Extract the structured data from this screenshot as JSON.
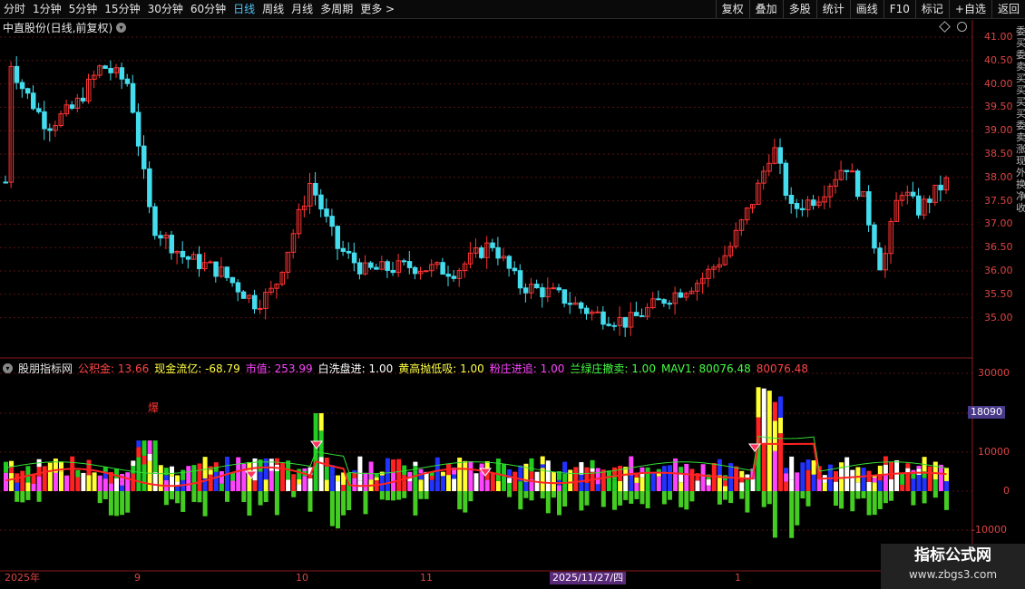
{
  "toolbar": {
    "periods": [
      "分时",
      "1分钟",
      "5分钟",
      "15分钟",
      "30分钟",
      "60分钟",
      "日线",
      "周线",
      "月线",
      "多周期",
      "更多 >"
    ],
    "active_period": "日线",
    "right_buttons": [
      "复权",
      "叠加",
      "多股",
      "统计",
      "画线",
      "F10",
      "标记",
      "+自选",
      "返回"
    ]
  },
  "stock": {
    "title": "中直股份(日线,前复权)"
  },
  "indicator": {
    "name": "股朋指标网",
    "items": [
      {
        "label": "公积金: 13.66",
        "color": "#ff4444"
      },
      {
        "label": "现金流亿: -68.79",
        "color": "#ffff44"
      },
      {
        "label": "市值: 253.99",
        "color": "#ff44ff"
      },
      {
        "label": "白洗盘进: 1.00",
        "color": "#ffffff"
      },
      {
        "label": "黄高抛低吸: 1.00",
        "color": "#ffff44"
      },
      {
        "label": "粉庄进追: 1.00",
        "color": "#ff44ff"
      },
      {
        "label": "兰绿庄撤卖: 1.00",
        "color": "#44ff44"
      },
      {
        "label": "MAV1: 80076.48",
        "color": "#44ff44"
      },
      {
        "label": "80076.48",
        "color": "#ff4444"
      }
    ],
    "bao_label": "爆"
  },
  "price_axis": [
    "41.00",
    "40.50",
    "40.00",
    "39.50",
    "39.00",
    "38.50",
    "38.00",
    "37.50",
    "37.00",
    "36.50",
    "36.00",
    "35.50",
    "35.00"
  ],
  "volume_axis": [
    "30000",
    "20000",
    "10000",
    "0",
    "-10000"
  ],
  "volume_badge": "18090",
  "date_axis": [
    {
      "label": "2025年",
      "pos": "left"
    },
    {
      "label": "9",
      "pos": "a"
    },
    {
      "label": "10",
      "pos": "b"
    },
    {
      "label": "11",
      "pos": "c"
    },
    {
      "label": "1",
      "pos": "d"
    }
  ],
  "date_badge": "2025/11/27/四",
  "sidebar_text": "委买委卖买买买买委卖涨现外换净收",
  "watermark": {
    "line1": "指标公式网",
    "line2": "www.zbgs3.com"
  },
  "colors": {
    "up": "#ff3333",
    "down": "#44ddee",
    "grid": "#5a1010",
    "border": "#8a1a1a"
  }
}
